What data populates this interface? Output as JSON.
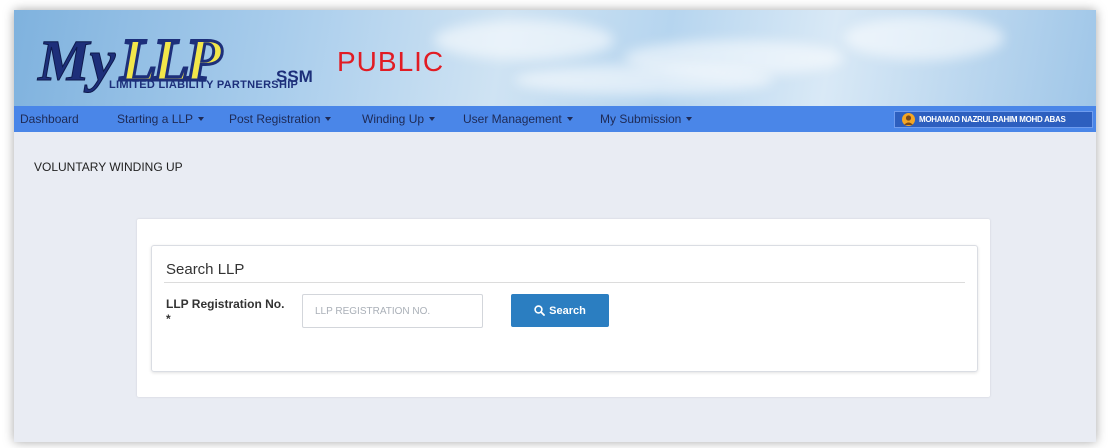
{
  "header": {
    "logo_text": "MyLLP",
    "ssm_text": "SSM",
    "subtitle": "LIMITED LIABILITY PARTNERSHIP",
    "public_label": "PUBLIC"
  },
  "nav": {
    "items": [
      {
        "label": "Dashboard",
        "dropdown": false
      },
      {
        "label": "Starting a LLP",
        "dropdown": true
      },
      {
        "label": "Post Registration",
        "dropdown": true
      },
      {
        "label": "Winding Up",
        "dropdown": true
      },
      {
        "label": "User Management",
        "dropdown": true
      },
      {
        "label": "My Submission",
        "dropdown": true
      }
    ],
    "user_name": "MOHAMAD NAZRULRAHIM MOHD ABAS"
  },
  "page": {
    "title": "VOLUNTARY WINDING UP"
  },
  "search": {
    "panel_title": "Search LLP",
    "field_label": "LLP Registration No. *",
    "placeholder": "LLP REGISTRATION NO.",
    "value": "",
    "button_label": "Search",
    "icon": "search-icon"
  },
  "colors": {
    "nav_bar": "#4a86e8",
    "nav_text": "#1e2a55",
    "button": "#2b7ec1",
    "public_text": "#e11c24",
    "background": "#e9ecf3"
  }
}
